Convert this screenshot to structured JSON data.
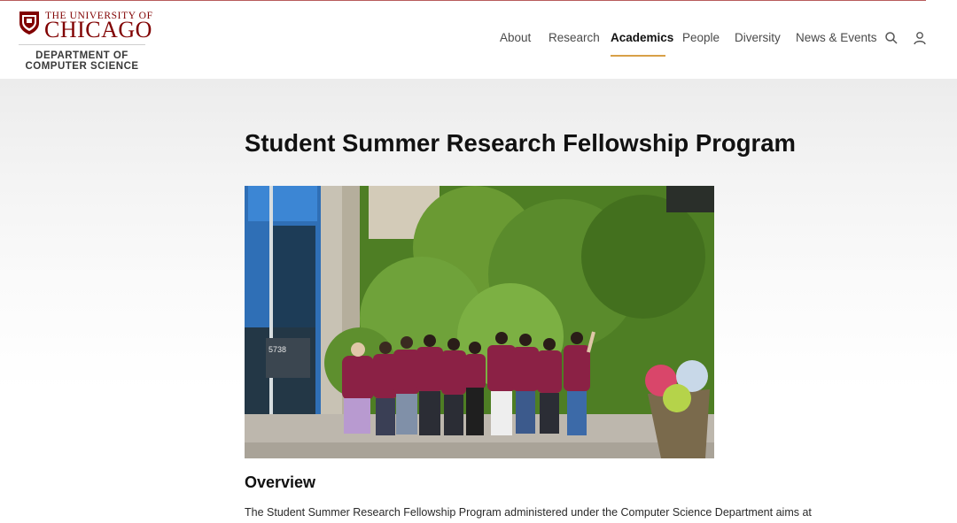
{
  "logo": {
    "line1": "THE UNIVERSITY OF",
    "line2": "CHICAGO",
    "dept1": "DEPARTMENT OF",
    "dept2": "COMPUTER SCIENCE"
  },
  "nav": {
    "items": [
      {
        "label": "About"
      },
      {
        "label": "Research"
      },
      {
        "label": "Academics",
        "active": true
      },
      {
        "label": "People"
      },
      {
        "label": "Diversity"
      },
      {
        "label": "News & Events"
      }
    ],
    "icons": [
      "search-icon",
      "user-icon"
    ]
  },
  "page": {
    "title": "Student Summer Research Fellowship Program",
    "photo_text": "5738",
    "section_heading": "Overview",
    "paragraph": "The Student Summer Research Fellowship Program administered under the Computer Science Department aims at"
  },
  "colors": {
    "maroon": "#800000",
    "accent_underline": "#d8a047",
    "shirt": "#8b2145"
  }
}
